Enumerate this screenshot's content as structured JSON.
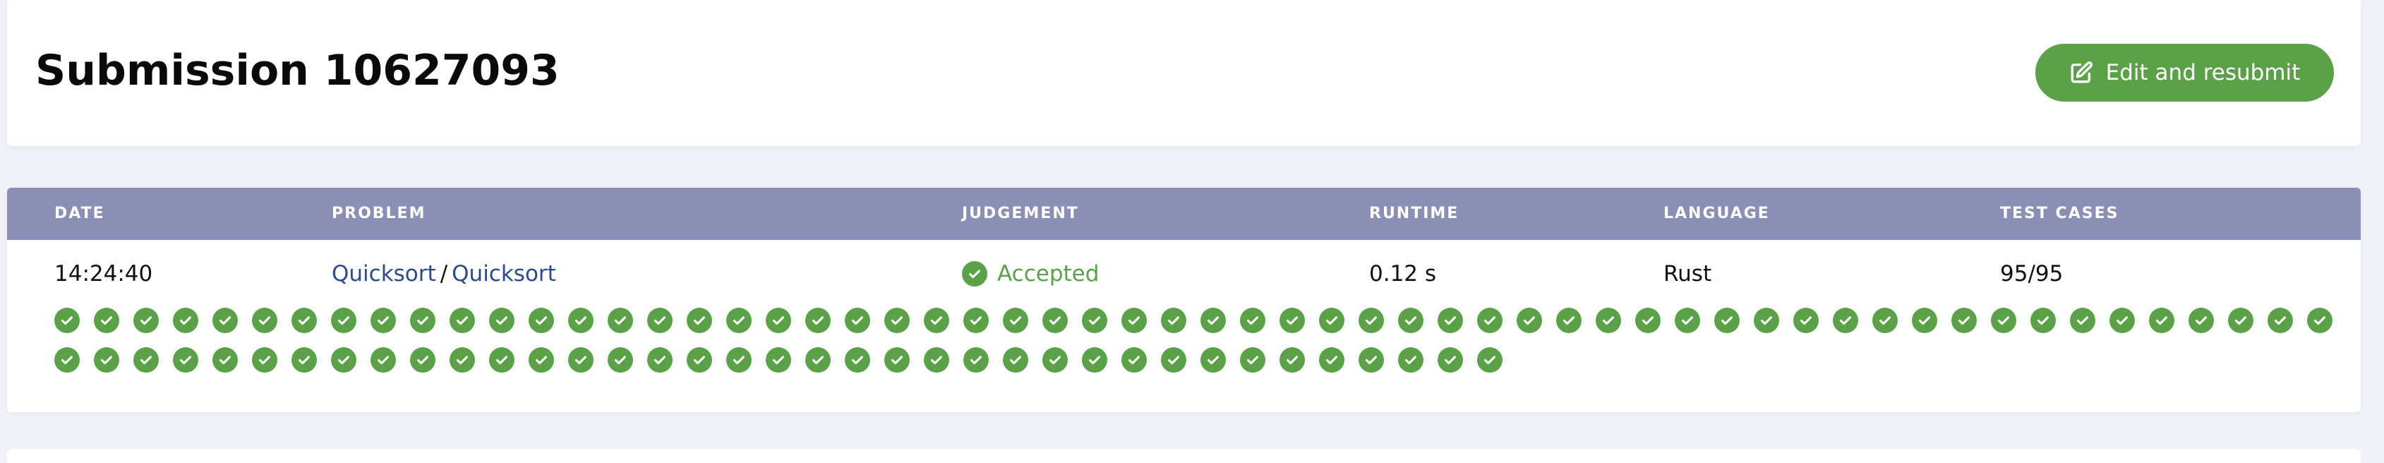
{
  "header": {
    "title": "Submission 10627093",
    "resubmit_label": "Edit and resubmit",
    "resubmit_icon": "edit-icon"
  },
  "table": {
    "columns": {
      "date": "DATE",
      "problem": "PROBLEM",
      "judgement": "JUDGEMENT",
      "runtime": "RUNTIME",
      "language": "LANGUAGE",
      "test_cases": "TEST CASES"
    },
    "row": {
      "date": "14:24:40",
      "problem_category": "Quicksort",
      "problem_separator": "/",
      "problem_name": "Quicksort",
      "judgement": "Accepted",
      "judgement_icon": "check-circle-icon",
      "runtime": "0.12 s",
      "language": "Rust",
      "test_cases": "95/95"
    },
    "test_case_results": {
      "passed": 95,
      "total": 95,
      "icon": "check-circle-icon"
    }
  },
  "colors": {
    "accent_green": "#5aa148",
    "header_bg": "#8b8fb5",
    "link": "#2b4a8f",
    "page_bg": "#f0f0f7"
  }
}
